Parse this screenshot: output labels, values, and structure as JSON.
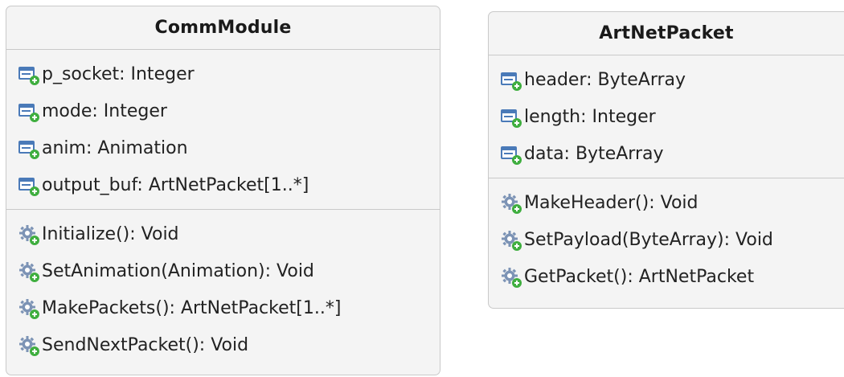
{
  "classes": [
    {
      "name": "CommModule",
      "attributes": [
        {
          "icon": "attribute-icon",
          "text": "p_socket: Integer"
        },
        {
          "icon": "attribute-icon",
          "text": "mode: Integer"
        },
        {
          "icon": "attribute-icon",
          "text": "anim: Animation"
        },
        {
          "icon": "attribute-icon",
          "text": "output_buf: ArtNetPacket[1..*]"
        }
      ],
      "operations": [
        {
          "icon": "operation-icon",
          "text": "Initialize(): Void"
        },
        {
          "icon": "operation-icon",
          "text": "SetAnimation(Animation): Void"
        },
        {
          "icon": "operation-icon",
          "text": "MakePackets(): ArtNetPacket[1..*]"
        },
        {
          "icon": "operation-icon",
          "text": "SendNextPacket(): Void"
        }
      ]
    },
    {
      "name": "ArtNetPacket",
      "attributes": [
        {
          "icon": "attribute-icon",
          "text": "header: ByteArray"
        },
        {
          "icon": "attribute-icon",
          "text": "length: Integer"
        },
        {
          "icon": "attribute-icon",
          "text": "data: ByteArray"
        }
      ],
      "operations": [
        {
          "icon": "operation-icon",
          "text": "MakeHeader(): Void"
        },
        {
          "icon": "operation-icon",
          "text": "SetPayload(ByteArray): Void"
        },
        {
          "icon": "operation-icon",
          "text": "GetPacket(): ArtNetPacket"
        }
      ]
    }
  ],
  "colors": {
    "box_fill": "#f4f4f4",
    "border": "#c9c9c9",
    "attribute_icon": "#4a7ab8",
    "operation_icon": "#7c93b5",
    "plus_badge": "#3fae3f"
  }
}
